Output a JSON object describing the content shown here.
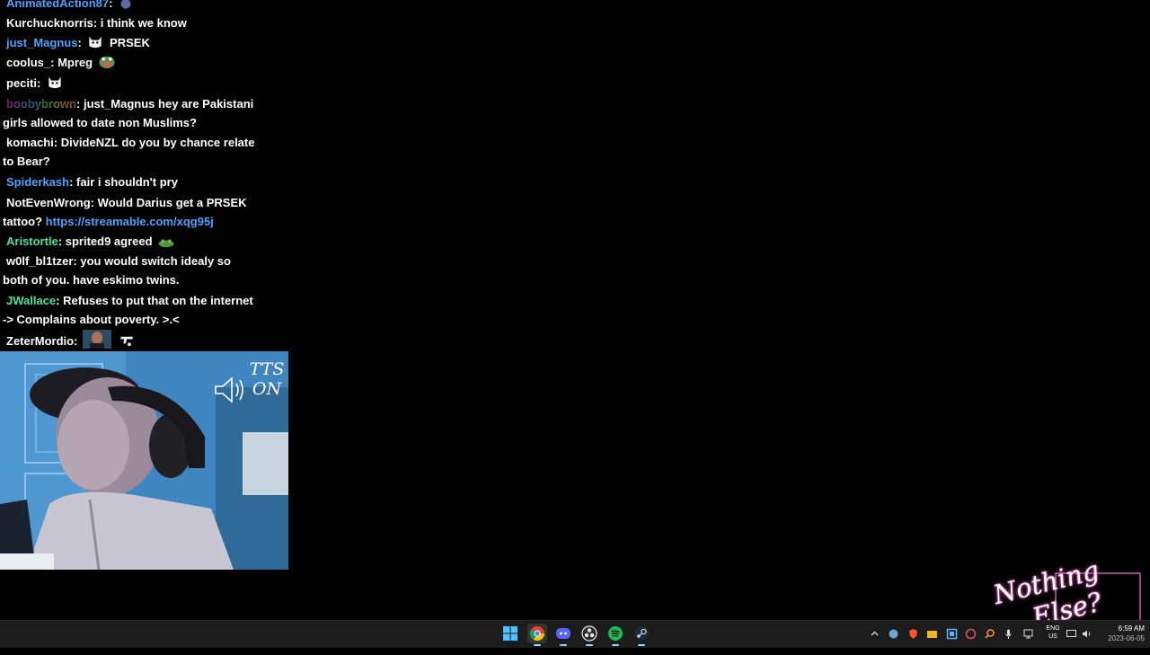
{
  "chat": {
    "messages": [
      {
        "user": "AnimatedAction87",
        "user_color": "#4aa3ff",
        "text": "",
        "emotes": [
          "cat-emote"
        ]
      },
      {
        "user": "Kurchucknorris",
        "user_color": "#ffffff",
        "text": "i think we know",
        "emotes": []
      },
      {
        "user": "just_Magnus",
        "user_color": "#4aa3ff",
        "text": "PRSEK",
        "emotes": [
          "white-cat-emote"
        ]
      },
      {
        "user": "coolus_",
        "user_color": "#ffffff",
        "text": "Mpreg",
        "emotes": [
          "pepe-emote"
        ]
      },
      {
        "user": "peciti",
        "user_color": "#ffffff",
        "text": "",
        "emotes": [
          "white-cat-emote"
        ]
      },
      {
        "user": "boobybrown",
        "user_color": "rainbow",
        "text": "just_Magnus hey are Pakistani girls allowed to date non Muslims?",
        "emotes": []
      },
      {
        "user": "komachi",
        "user_color": "#ffffff",
        "text": "DivideNZL do you by chance relate to Bear?",
        "emotes": []
      },
      {
        "user": "Spiderkash",
        "user_color": "#4aa3ff",
        "text": "fair i shouldn't pry",
        "emotes": []
      },
      {
        "user": "NotEvenWrong",
        "user_color": "#ffffff",
        "text": "Would Darius get a PRSEK tattoo?",
        "link": "https://streamable.com/xqg95j",
        "emotes": []
      },
      {
        "user": "Aristortle",
        "user_color": "#4be39b",
        "text": "sprited9 agreed",
        "emotes": [
          "frog-emote"
        ]
      },
      {
        "user": "w0lf_bl1tzer",
        "user_color": "#ffffff",
        "text": "you would switch idealy so both of you. have eskimo twins.",
        "emotes": []
      },
      {
        "user": "JWallace",
        "user_color": "#4be39b",
        "text": "Refuses to put that on the internet -> Complains about poverty. >.<",
        "emotes": []
      },
      {
        "user": "ZeterMordio",
        "user_color": "#ffffff",
        "text": "",
        "emotes": [
          "portrait-emote",
          "gun-emote"
        ]
      }
    ]
  },
  "overlay": {
    "tts_label": "TTS ON",
    "tts_line1": "TTS",
    "tts_line2": "ON",
    "logo_line1": "Nothing",
    "logo_line2": "Else?"
  },
  "taskbar": {
    "apps": [
      {
        "name": "start-icon",
        "active": false
      },
      {
        "name": "chrome-icon",
        "active": true
      },
      {
        "name": "discord-icon",
        "active": true
      },
      {
        "name": "obs-icon",
        "active": true
      },
      {
        "name": "spotify-icon",
        "active": true
      },
      {
        "name": "steam-icon",
        "active": true
      }
    ],
    "lang_line1": "ENG",
    "lang_line2": "US",
    "time": "6:59 AM",
    "date": "2023-06-05"
  },
  "colors": {
    "background": "#000000",
    "link": "#4aa3ff",
    "username_blue": "#4aa3ff",
    "username_green": "#4be39b",
    "logo_glow": "#ff6fd8",
    "taskbar": "#1c1c1c"
  }
}
